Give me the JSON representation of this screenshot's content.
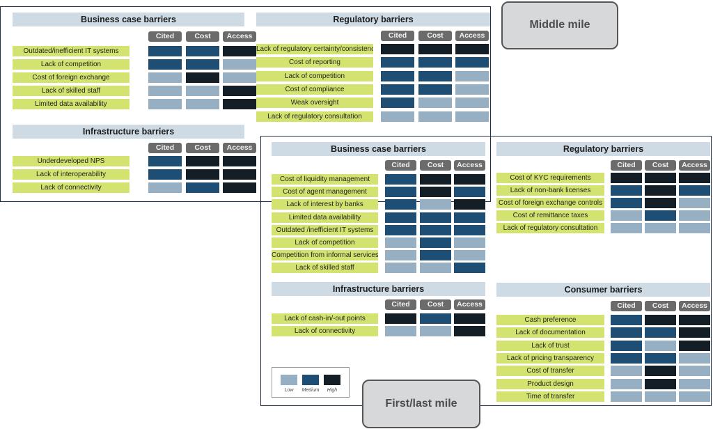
{
  "legend": {
    "levels": [
      {
        "label": "Low",
        "color": "#97afc2"
      },
      {
        "label": "Medium",
        "color": "#1f4e74"
      },
      {
        "label": "High",
        "color": "#131e27"
      }
    ]
  },
  "columns": [
    "Cited",
    "Cost",
    "Access"
  ],
  "middle_mile": {
    "label": "Middle mile",
    "sections": [
      {
        "id": "mm-business",
        "title": "Business case barriers",
        "rows": [
          {
            "label": "Outdated/inefficient IT systems",
            "values": [
              "Medium",
              "Medium",
              "High"
            ]
          },
          {
            "label": "Lack of competition",
            "values": [
              "Medium",
              "Medium",
              "Low"
            ]
          },
          {
            "label": "Cost of foreign exchange",
            "values": [
              "Low",
              "High",
              "Low"
            ]
          },
          {
            "label": "Lack of skilled staff",
            "values": [
              "Low",
              "Low",
              "High"
            ]
          },
          {
            "label": "Limited data availability",
            "values": [
              "Low",
              "Low",
              "High"
            ]
          }
        ]
      },
      {
        "id": "mm-infrastructure",
        "title": "Infrastructure barriers",
        "rows": [
          {
            "label": "Underdeveloped NPS",
            "values": [
              "Medium",
              "High",
              "High"
            ]
          },
          {
            "label": "Lack of interoperability",
            "values": [
              "Medium",
              "High",
              "High"
            ]
          },
          {
            "label": "Lack of connectivity",
            "values": [
              "Low",
              "Medium",
              "High"
            ]
          }
        ]
      },
      {
        "id": "mm-regulatory",
        "title": "Regulatory barriers",
        "rows": [
          {
            "label": "Lack of regulatory certainty/consistency",
            "values": [
              "High",
              "High",
              "High"
            ]
          },
          {
            "label": "Cost of reporting",
            "values": [
              "Medium",
              "Medium",
              "Medium"
            ]
          },
          {
            "label": "Lack of competition",
            "values": [
              "Medium",
              "Medium",
              "Low"
            ]
          },
          {
            "label": "Cost of compliance",
            "values": [
              "Medium",
              "Medium",
              "Low"
            ]
          },
          {
            "label": "Weak oversight",
            "values": [
              "Medium",
              "Low",
              "Low"
            ]
          },
          {
            "label": "Lack of regulatory consultation",
            "values": [
              "Low",
              "Low",
              "Low"
            ]
          }
        ]
      }
    ]
  },
  "first_last_mile": {
    "label": "First/last mile",
    "sections": [
      {
        "id": "fl-business",
        "title": "Business case barriers",
        "rows": [
          {
            "label": "Cost of liquidity management",
            "values": [
              "Medium",
              "High",
              "High"
            ]
          },
          {
            "label": "Cost of agent management",
            "values": [
              "Medium",
              "High",
              "Medium"
            ]
          },
          {
            "label": "Lack of interest by banks",
            "values": [
              "Medium",
              "Low",
              "High"
            ]
          },
          {
            "label": "Limited data availability",
            "values": [
              "Medium",
              "Medium",
              "Medium"
            ]
          },
          {
            "label": "Outdated /inefficient IT systems",
            "values": [
              "Medium",
              "Medium",
              "Medium"
            ]
          },
          {
            "label": "Lack of competition",
            "values": [
              "Low",
              "Medium",
              "Low"
            ]
          },
          {
            "label": "Competition from informal services",
            "values": [
              "Low",
              "Medium",
              "Low"
            ]
          },
          {
            "label": "Lack of skilled staff",
            "values": [
              "Low",
              "Low",
              "Medium"
            ]
          }
        ]
      },
      {
        "id": "fl-infrastructure",
        "title": "Infrastructure barriers",
        "rows": [
          {
            "label": "Lack of cash-in/-out points",
            "values": [
              "High",
              "Medium",
              "High"
            ]
          },
          {
            "label": "Lack of connectivity",
            "values": [
              "Low",
              "Low",
              "High"
            ]
          }
        ]
      },
      {
        "id": "fl-regulatory",
        "title": "Regulatory barriers",
        "rows": [
          {
            "label": "Cost of KYC requirements",
            "values": [
              "High",
              "High",
              "High"
            ]
          },
          {
            "label": "Lack of non-bank licenses",
            "values": [
              "Medium",
              "High",
              "Medium"
            ]
          },
          {
            "label": "Cost of foreign exchange controls",
            "values": [
              "Medium",
              "High",
              "Low"
            ]
          },
          {
            "label": "Cost of remittance taxes",
            "values": [
              "Low",
              "Medium",
              "Low"
            ]
          },
          {
            "label": "Lack of regulatory consultation",
            "values": [
              "Low",
              "Low",
              "Low"
            ]
          }
        ]
      },
      {
        "id": "fl-consumer",
        "title": "Consumer barriers",
        "rows": [
          {
            "label": "Cash preference",
            "values": [
              "Medium",
              "High",
              "High"
            ]
          },
          {
            "label": "Lack of documentation",
            "values": [
              "Medium",
              "Medium",
              "High"
            ]
          },
          {
            "label": "Lack of trust",
            "values": [
              "Medium",
              "Low",
              "High"
            ]
          },
          {
            "label": "Lack of pricing transparency",
            "values": [
              "Medium",
              "Medium",
              "Low"
            ]
          },
          {
            "label": "Cost of transfer",
            "values": [
              "Low",
              "High",
              "Low"
            ]
          },
          {
            "label": "Product design",
            "values": [
              "Low",
              "High",
              "Low"
            ]
          },
          {
            "label": "Time of transfer",
            "values": [
              "Low",
              "Low",
              "Low"
            ]
          }
        ]
      }
    ]
  }
}
